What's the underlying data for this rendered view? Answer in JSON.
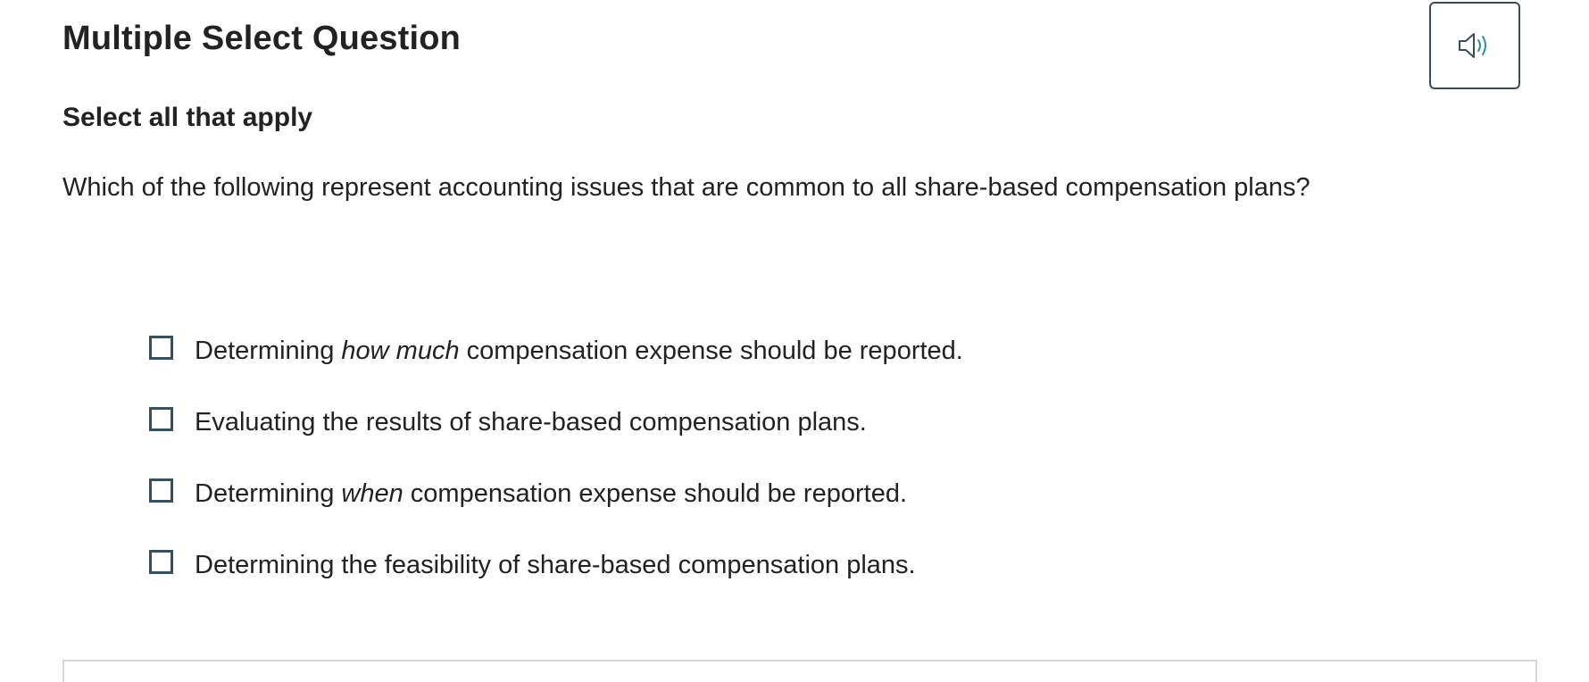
{
  "header": {
    "title": "Multiple Select Question",
    "audio_icon": "speaker-icon"
  },
  "question": {
    "instruction": "Select all that apply",
    "prompt": "Which of the following represent accounting issues that are common to all share-based compensation plans?"
  },
  "options": [
    {
      "before": "Determining ",
      "emphasis": "how much",
      "after": " compensation expense should be reported.",
      "checked": false
    },
    {
      "before": "Evaluating the results of share-based compensation plans.",
      "emphasis": "",
      "after": "",
      "checked": false
    },
    {
      "before": "Determining ",
      "emphasis": "when",
      "after": " compensation expense should be reported.",
      "checked": false
    },
    {
      "before": "Determining the feasibility of share-based compensation plans.",
      "emphasis": "",
      "after": "",
      "checked": false
    }
  ],
  "colors": {
    "text": "#222222",
    "checkbox_border": "#37505d",
    "audio_accent": "#2e8f98",
    "panel_border": "#d3d6d8"
  }
}
